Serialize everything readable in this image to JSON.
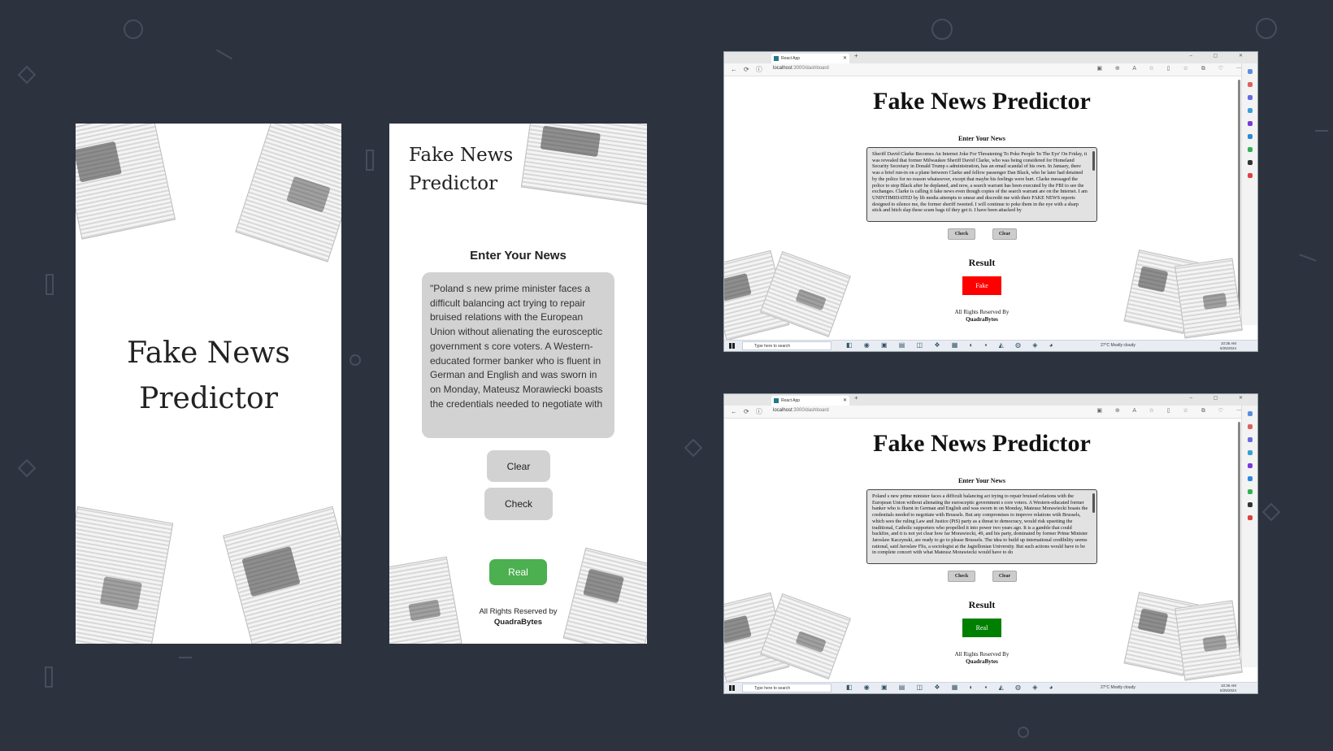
{
  "splash": {
    "title_line1": "Fake News",
    "title_line2": "Predictor"
  },
  "mobile": {
    "title": "Fake News Predictor",
    "enter_label": "Enter Your News",
    "news_text": "\"Poland s new prime minister faces a difficult balancing act trying to repair bruised relations with the European Union without alienating the eurosceptic government s core voters. A Western-educated former banker who is fluent in German and English and was sworn in on Monday, Mateusz Morawiecki boasts the credentials needed to negotiate with",
    "clear_label": "Clear",
    "check_label": "Check",
    "result": "Real",
    "result_color": "#4caf50",
    "footer_line1": "All Rights Reserved by",
    "footer_line2": "QuadraBytes"
  },
  "browser_common": {
    "tab_title": "React App",
    "url_host": "localhost",
    "url_path": ":3000/dashboard",
    "page_title": "Fake News Predictor",
    "enter_label": "Enter Your News",
    "check_label": "Check",
    "clear_label": "Clear",
    "result_label": "Result",
    "footer_line1": "All Rights Reserved By",
    "footer_line2": "QuadraBytes",
    "taskbar_search": "Type here to search",
    "weather": "27°C Mostly cloudy",
    "time": "10:36 AM",
    "date": "6/25/2024"
  },
  "window1": {
    "news_text": "Sheriff David Clarke Becomes An Internet Joke For Threatening To Poke People 'In The Eye' On Friday, it was revealed that former Milwaukee Sheriff David Clarke, who was being considered for Homeland Security Secretary in Donald Trump s administration, has an email scandal of his own. In January, there was a brief run-in on a plane between Clarke and fellow passenger Dan Black, who he later had detained by the police for no reason whatsoever, except that maybe his feelings were hurt. Clarke messaged the police to stop Black after he deplaned, and now, a search warrant has been executed by the FBI to see the exchanges. Clarke is calling it fake news even though copies of the search warrant are on the Internet. I am UNINTIMIDATED by lib media attempts to smear and discredit me with their FAKE NEWS reports designed to silence me, the former sheriff tweeted. I will continue to poke them in the eye with a sharp stick and bitch slap these scum bags til they get it. I have been attacked by",
    "result": "Fake",
    "result_color": "#ff0000"
  },
  "window2": {
    "news_text": "Poland s new prime minister faces a difficult balancing act trying to repair bruised relations with the European Union without alienating the eurosceptic government s core voters. A Western-educated former banker who is fluent in German and English and was sworn in on Monday, Mateusz Morawiecki boasts the credentials needed to negotiate with Brussels. But any compromises to improve relations with Brussels, which sees the ruling Law and Justice (PiS) party as a threat to democracy, would risk upsetting the traditional, Catholic supporters who propelled it into power two years ago. It is a gamble that could backfire, and it is not yet clear how far Morawiecki, 49, and his party, dominated by former Prime Minister Jaroslaw Kaczynski, are ready to go to please Brussels. The idea to build up international credibility seems rational, said Jaroslaw Flis, a sociologist at the Jagiellonian University. But such actions would have to be in complete concert with what Mateusz Morawiecki would have to do",
    "result": "Real",
    "result_color": "#008000"
  },
  "icons": {
    "back": "←",
    "refresh": "⟳",
    "info": "ⓘ",
    "close": "✕",
    "plus": "+",
    "window_controls": "– ▢ ✕",
    "toolbar": "▣ ⊕ A ☆ ▯ ☆ ⧉ ♡ ⋯",
    "taskbar_apps": "◧ ◉ ▣ ▤ ◫ ❖ ▦ ◐ ▪ ◭ ◍ ◈ ◕"
  }
}
